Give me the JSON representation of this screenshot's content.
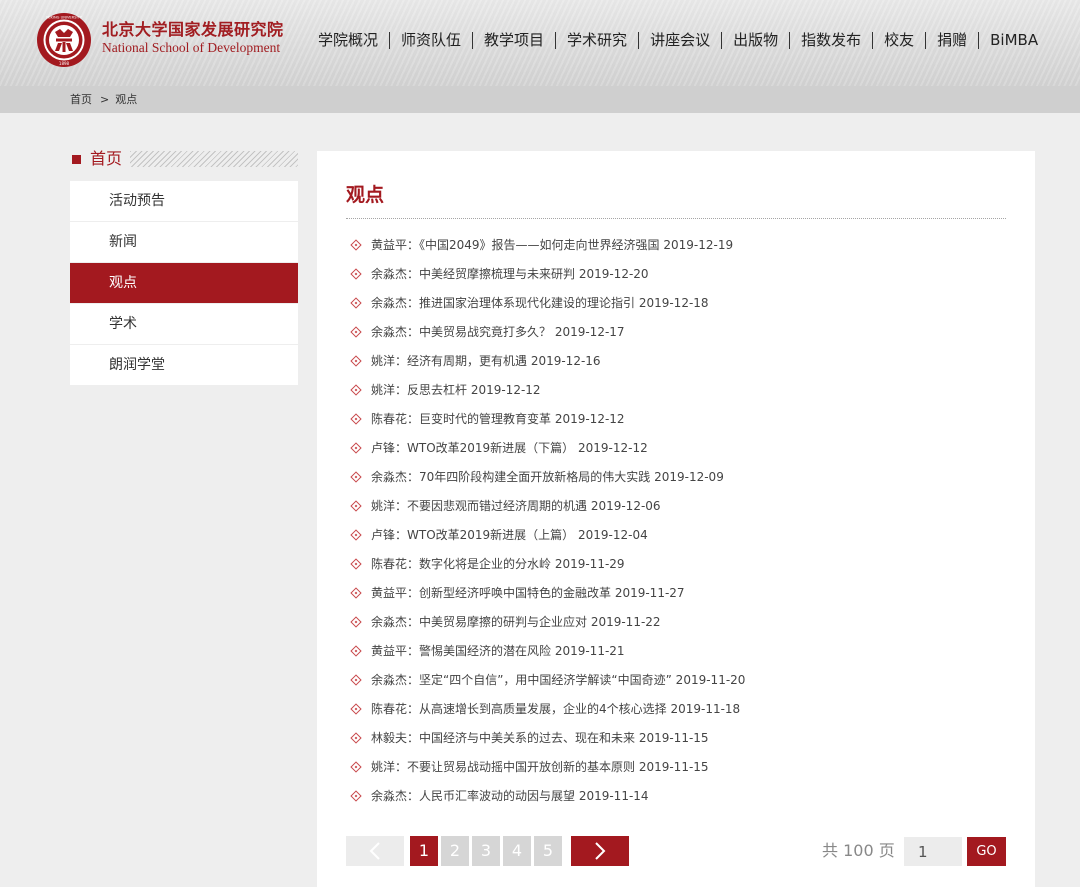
{
  "header": {
    "brand_cn": "北京大学国家发展研究院",
    "brand_en": "National School of Development",
    "logo_text_top": "PEKING UNIVERSITY",
    "logo_year": "1898",
    "nav": [
      "学院概况",
      "师资队伍",
      "教学项目",
      "学术研究",
      "讲座会议",
      "出版物",
      "指数发布",
      "校友",
      "捐赠",
      "BiMBA"
    ]
  },
  "breadcrumb": {
    "home": "首页",
    "separator": ">",
    "current": "观点"
  },
  "sidebar": {
    "title": "首页",
    "items": [
      {
        "label": "活动预告",
        "active": false
      },
      {
        "label": "新闻",
        "active": false
      },
      {
        "label": "观点",
        "active": true
      },
      {
        "label": "学术",
        "active": false
      },
      {
        "label": "朗润学堂",
        "active": false
      }
    ]
  },
  "main": {
    "title": "观点",
    "articles": [
      "黄益平：《中国2049》报告——如何走向世界经济强国 2019-12-19",
      "余淼杰：中美经贸摩擦梳理与未来研判 2019-12-20",
      "余淼杰：推进国家治理体系现代化建设的理论指引 2019-12-18",
      "余淼杰：中美贸易战究竟打多久？ 2019-12-17",
      "姚洋：经济有周期，更有机遇 2019-12-16",
      "姚洋：反思去杠杆 2019-12-12",
      "陈春花：巨变时代的管理教育变革 2019-12-12",
      "卢锋：WTO改革2019新进展（下篇） 2019-12-12",
      "余淼杰：70年四阶段构建全面开放新格局的伟大实践 2019-12-09",
      "姚洋：不要因悲观而错过经济周期的机遇 2019-12-06",
      "卢锋：WTO改革2019新进展（上篇） 2019-12-04",
      "陈春花：数字化将是企业的分水岭 2019-11-29",
      "黄益平：创新型经济呼唤中国特色的金融改革 2019-11-27",
      "余淼杰：中美贸易摩擦的研判与企业应对 2019-11-22",
      "黄益平：警惕美国经济的潜在风险 2019-11-21",
      "余淼杰：坚定“四个自信”，用中国经济学解读“中国奇迹” 2019-11-20",
      "陈春花：从高速增长到高质量发展，企业的4个核心选择 2019-11-18",
      "林毅夫：中国经济与中美关系的过去、现在和未来 2019-11-15",
      "姚洋：不要让贸易战动摇中国开放创新的基本原则 2019-11-15",
      "余淼杰：人民币汇率波动的动因与展望 2019-11-14"
    ]
  },
  "pagination": {
    "pages": [
      "1",
      "2",
      "3",
      "4",
      "5"
    ],
    "current": "1",
    "total_text": "共 100 页",
    "jump_value": "1",
    "go_label": "GO",
    "prev_icon": "chevron-left-icon",
    "next_icon": "chevron-right-icon"
  },
  "colors": {
    "accent": "#a3191f",
    "header_bg": "#dcdcdc",
    "breadcrumb_bg": "#cfcfcf",
    "page_bg": "#eeeeee"
  }
}
